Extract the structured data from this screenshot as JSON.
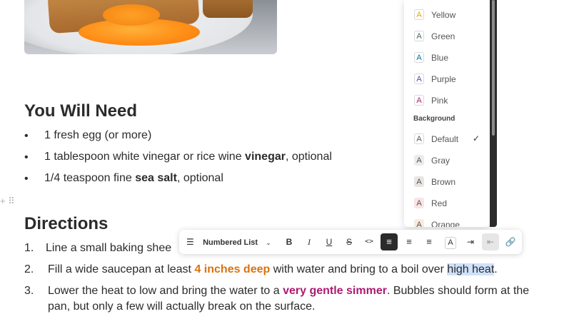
{
  "photo": {
    "alt_icon": "food-photo"
  },
  "sections": {
    "need_heading": "You Will Need",
    "directions_heading": "Directions"
  },
  "need_items": [
    {
      "prefix": "1 fresh egg (or more)",
      "bold": "",
      "suffix": ""
    },
    {
      "prefix": "1 tablespoon white vinegar or rice wine ",
      "bold": "vinegar",
      "suffix": ", optional"
    },
    {
      "prefix": "1/4 teaspoon fine ",
      "bold": "sea salt",
      "suffix": ", optional"
    }
  ],
  "directions": [
    {
      "num": "1.",
      "text": "Line a small baking shee"
    },
    {
      "num": "2.",
      "prefix": "Fill a wide saucepan at least ",
      "highlight": "4 inches deep",
      "middle": " with water and bring to a boil over ",
      "selected": "high heat",
      "suffix": "."
    },
    {
      "num": "3.",
      "prefix": "Lower the heat to low and bring the water to a ",
      "highlight": "very gentle simmer",
      "line1_suffix": ". Bubbles should form at the",
      "line2": "pan, but only a few will actually break on the surface."
    }
  ],
  "color_menu": {
    "text_colors": [
      {
        "label": "Yellow",
        "color": "#dfab01"
      },
      {
        "label": "Green",
        "color": "#4d6461"
      },
      {
        "label": "Blue",
        "color": "#0b6e99"
      },
      {
        "label": "Purple",
        "color": "#6940a5"
      },
      {
        "label": "Pink",
        "color": "#ad1a72"
      }
    ],
    "background_heading": "Background",
    "backgrounds": [
      {
        "label": "Default",
        "bg": "#ffffff",
        "selected": true
      },
      {
        "label": "Gray",
        "bg": "#ebeced",
        "selected": false
      },
      {
        "label": "Brown",
        "bg": "#e9e5e3",
        "selected": false
      },
      {
        "label": "Red",
        "bg": "#fbe4e4",
        "selected": false
      },
      {
        "label": "Orange",
        "bg": "#faebdd",
        "selected": false
      }
    ],
    "swatch_letter": "A"
  },
  "toolbar": {
    "block_type": "Numbered List",
    "bold": "B",
    "italic": "I",
    "underline": "U",
    "strike": "S",
    "code": "<>",
    "color": "A"
  }
}
